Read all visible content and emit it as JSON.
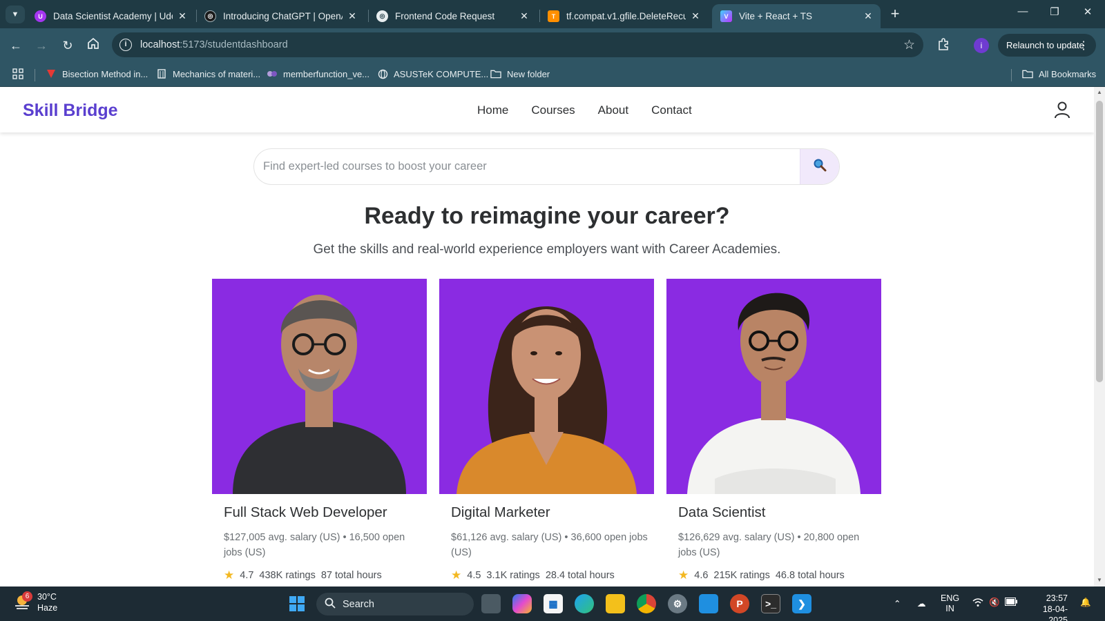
{
  "browser": {
    "tabs": [
      {
        "title": "Data Scientist Academy | Udem",
        "favicon_color": "#a435f0",
        "favicon_letter": "U"
      },
      {
        "title": "Introducing ChatGPT | OpenAI",
        "favicon_color": "#1a1a1a",
        "favicon_letter": "◎"
      },
      {
        "title": "Frontend Code Request",
        "favicon_color": "#e8eef0",
        "favicon_letter": "◎"
      },
      {
        "title": "tf.compat.v1.gfile.DeleteRecursi",
        "favicon_color": "#ff8f00",
        "favicon_letter": "T"
      },
      {
        "title": "Vite + React + TS",
        "favicon_color": "#a855f7",
        "favicon_letter": "V"
      }
    ],
    "url_host": "localhost",
    "url_rest": ":5173/studentdashboard",
    "profile_letter": "i",
    "relaunch_label": "Relaunch to update",
    "bookmarks": [
      {
        "label": "Bisection Method in...",
        "icon_color": "#e53935"
      },
      {
        "label": "Mechanics of materi...",
        "icon_color": "#e8eef0"
      },
      {
        "label": "memberfunction_ve...",
        "icon_color": "#b39ddb"
      },
      {
        "label": "ASUSTeK COMPUTE...",
        "icon_color": "#e8eef0"
      },
      {
        "label": "New folder",
        "icon_color": "#e8eef0"
      }
    ],
    "all_bookmarks": "All Bookmarks"
  },
  "page": {
    "brand": "Skill Bridge",
    "brand_color": "#5a3fcf",
    "nav": [
      "Home",
      "Courses",
      "About",
      "Contact"
    ],
    "search_placeholder": "Find expert-led courses to boost your career",
    "hero_title": "Ready to reimagine your career?",
    "hero_subtitle": "Get the skills and real-world experience employers want with Career Academies.",
    "card_bg": "#8a2be2",
    "cards": [
      {
        "role": "Full Stack Web Developer",
        "meta": "$127,005 avg. salary (US)  •  16,500 open jobs (US)",
        "rating": "4.7",
        "ratings": "438K ratings",
        "hours": "87 total hours",
        "shirt": "#2e2f33",
        "skin": "#b7866a",
        "hair": "#3a3a3a"
      },
      {
        "role": "Digital Marketer",
        "meta": "$61,126 avg. salary (US)  •  36,600 open jobs (US)",
        "rating": "4.5",
        "ratings": "3.1K ratings",
        "hours": "28.4 total hours",
        "shirt": "#d9892c",
        "skin": "#c99274",
        "hair": "#3b241a"
      },
      {
        "role": "Data Scientist",
        "meta": "$126,629 avg. salary (US)  •  20,800 open jobs (US)",
        "rating": "4.6",
        "ratings": "215K ratings",
        "hours": "46.8 total hours",
        "shirt": "#f4f4f2",
        "skin": "#b98465",
        "hair": "#1e1a18"
      }
    ]
  },
  "taskbar": {
    "temp": "30°C",
    "condition": "Haze",
    "weather_badge": "6",
    "search_label": "Search",
    "lang_1": "ENG",
    "lang_2": "IN",
    "time": "23:57",
    "date": "18-04-2025"
  }
}
